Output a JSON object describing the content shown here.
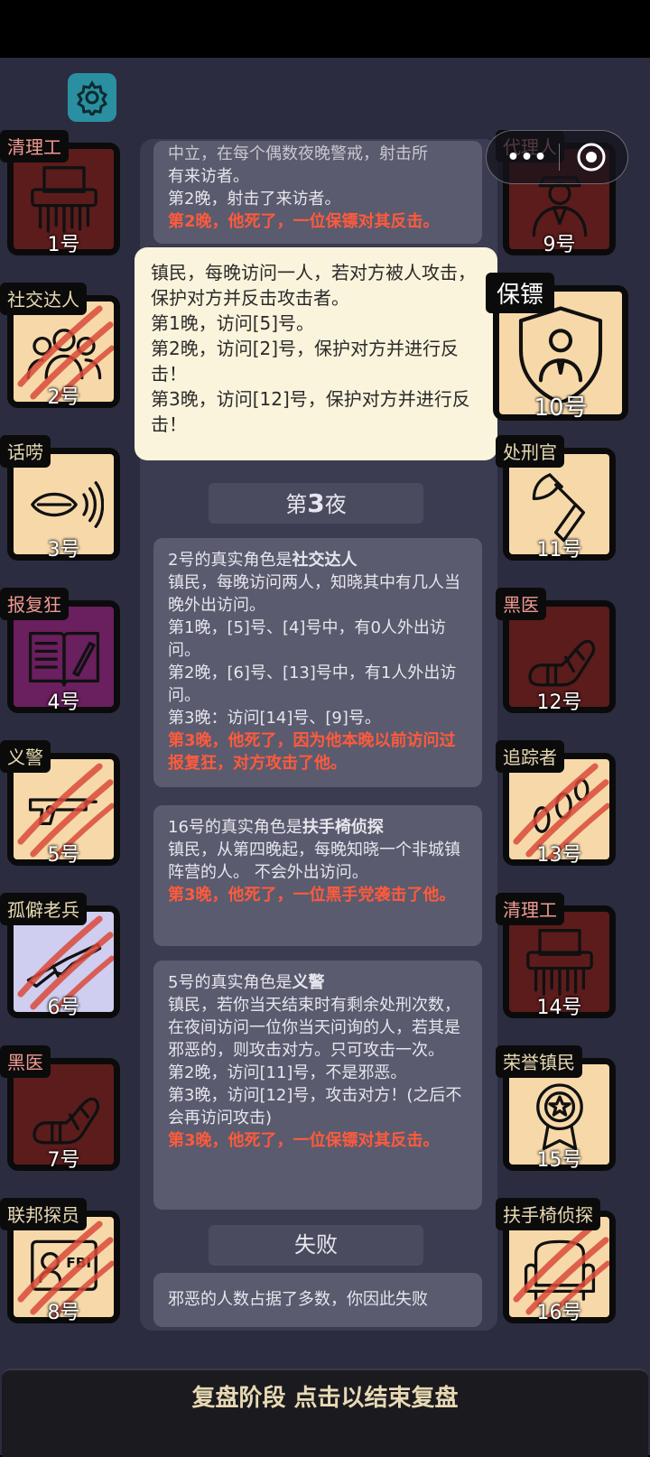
{
  "header": {
    "settings_icon": "gear-icon"
  },
  "capsule": {
    "more_label": "•••",
    "target_icon": "target-icon"
  },
  "players": [
    {
      "role": "清理工",
      "num": "1号",
      "bg": "#5c1c1c",
      "icon": "shredder-icon",
      "claw": false
    },
    {
      "role": "社交达人",
      "num": "2号",
      "bg": "#f7d9a9",
      "icon": "crowd-icon",
      "claw": true
    },
    {
      "role": "话唠",
      "num": "3号",
      "bg": "#f7d9a9",
      "icon": "mouth-icon",
      "claw": false
    },
    {
      "role": "报复狂",
      "num": "4号",
      "bg": "#6a1f5e",
      "icon": "book-icon",
      "claw": false
    },
    {
      "role": "义警",
      "num": "5号",
      "bg": "#f7d9a9",
      "icon": "gun-icon",
      "claw": true
    },
    {
      "role": "孤僻老兵",
      "num": "6号",
      "bg": "#cfcdf0",
      "icon": "rifle-icon",
      "claw": true
    },
    {
      "role": "黑医",
      "num": "7号",
      "bg": "#5c1c1c",
      "icon": "bandaged-arm-icon",
      "claw": false
    },
    {
      "role": "联邦探员",
      "num": "8号",
      "bg": "#f7d9a9",
      "icon": "fbi-badge-icon",
      "claw": true
    },
    {
      "role": "代理人",
      "num": "9号",
      "bg": "#5c1c1c",
      "icon": "agent-icon",
      "claw": false
    },
    {
      "role": "保镖",
      "num": "10号",
      "bg": "#f7d9a9",
      "icon": "shield-person-icon",
      "claw": false
    },
    {
      "role": "处刑官",
      "num": "11号",
      "bg": "#f7d9a9",
      "icon": "axe-icon",
      "claw": false
    },
    {
      "role": "黑医",
      "num": "12号",
      "bg": "#5c1c1c",
      "icon": "bandaged-arm-icon",
      "claw": false
    },
    {
      "role": "追踪者",
      "num": "13号",
      "bg": "#f7d9a9",
      "icon": "footprints-icon",
      "claw": true
    },
    {
      "role": "清理工",
      "num": "14号",
      "bg": "#5c1c1c",
      "icon": "shredder-icon",
      "claw": false
    },
    {
      "role": "荣誉镇民",
      "num": "15号",
      "bg": "#f7d9a9",
      "icon": "medal-icon",
      "claw": false
    },
    {
      "role": "扶手椅侦探",
      "num": "16号",
      "bg": "#f7d9a9",
      "icon": "armchair-icon",
      "claw": true
    }
  ],
  "log": {
    "top_msg": {
      "line0": "中立，在每个偶数夜晚警戒，射击所",
      "line1": "有来访者。",
      "line2": "第2晚，射击了来访者。",
      "red": "第2晚，他死了，一位保镖对其反击。"
    },
    "popup": {
      "line1": "镇民，每晚访问一人，若对方被人攻击，保护对方并反击攻击者。",
      "line2": "第1晚，访问[5]号。",
      "line3": "第2晚，访问[2]号，保护对方并进行反击！",
      "line4": "第3晚，访问[12]号，保护对方并进行反击！"
    },
    "night3_prefix": "第",
    "night3_num": "3",
    "night3_suffix": "夜",
    "msg1": {
      "head": "2号的真实角色是",
      "head_bold": "社交达人",
      "l1": "镇民，每晚访问两人，知晓其中有几人当晚外出访问。",
      "l2": "第1晚，[5]号、[4]号中，有0人外出访问。",
      "l3": "第2晚，[6]号、[13]号中，有1人外出访问。",
      "l4": "第3晚：访问[14]号、[9]号。",
      "red": "第3晚，他死了，因为他本晚以前访问过报复狂，对方攻击了他。"
    },
    "msg2": {
      "head": "16号的真实角色是",
      "head_bold": "扶手椅侦探",
      "l1": "镇民，从第四晚起，每晚知晓一个非城镇阵营的人。 不会外出访问。",
      "red": "第3晚，他死了，一位黑手党袭击了他。"
    },
    "msg3": {
      "head": "5号的真实角色是",
      "head_bold": "义警",
      "l1": "镇民，若你当天结束时有剩余处刑次数，在夜间访问一位你当天问询的人，若其是邪恶的，则攻击对方。只可攻击一次。",
      "l2": "第2晚，访问[11]号，不是邪恶。",
      "l3": "第3晚，访问[12]号，攻击对方！(之后不会再访问攻击)",
      "red": "第3晚，他死了，一位保镖对其反击。"
    },
    "fail_label": "失败",
    "fail_msg": "邪恶的人数占据了多数，你因此失败"
  },
  "footer": {
    "label": "复盘阶段 点击以结束复盘"
  }
}
